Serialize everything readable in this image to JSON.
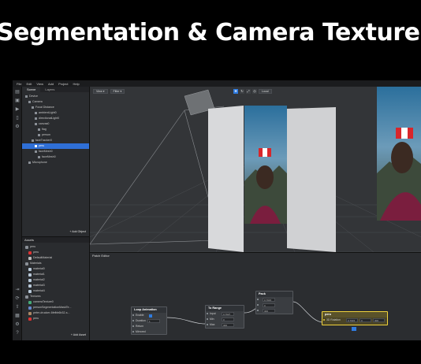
{
  "headline": "Segmentation & Camera Texture",
  "menubar": [
    "File",
    "Edit",
    "View",
    "Add",
    "Project",
    "Help"
  ],
  "tools": [
    "layers-icon",
    "picture-icon",
    "play-icon",
    "device-icon",
    "tools-icon"
  ],
  "scene_panel": {
    "tabs": [
      "Scene",
      "Layers"
    ],
    "tree": [
      {
        "label": "Device",
        "indent": 1,
        "selected": false
      },
      {
        "label": "Camera",
        "indent": 2,
        "selected": false
      },
      {
        "label": "Focal Distance",
        "indent": 3,
        "selected": false
      },
      {
        "label": "ambientLight0",
        "indent": 4,
        "selected": false
      },
      {
        "label": "directionalLight0",
        "indent": 4,
        "selected": false
      },
      {
        "label": "canvas0",
        "indent": 4,
        "selected": false
      },
      {
        "label": "flag",
        "indent": 5,
        "selected": false
      },
      {
        "label": "person",
        "indent": 5,
        "selected": false
      },
      {
        "label": "faceTracker0",
        "indent": 3,
        "selected": false
      },
      {
        "label": "peru",
        "indent": 4,
        "selected": true
      },
      {
        "label": "faceMesh0",
        "indent": 4,
        "selected": false
      },
      {
        "label": "faceMesh0",
        "indent": 5,
        "selected": false
      },
      {
        "label": "Microphone",
        "indent": 2,
        "selected": false
      }
    ],
    "add_object": "+ Add Object"
  },
  "assets_panel": {
    "title": "Assets",
    "items": [
      {
        "label": "peru",
        "indent": 1,
        "color": "#8a8f96"
      },
      {
        "label": "peru",
        "indent": 2,
        "color": "#d33"
      },
      {
        "label": "DefaultMaterial",
        "indent": 2,
        "color": "#bbb"
      },
      {
        "label": "Materials",
        "indent": 1,
        "color": "#8a8f96"
      },
      {
        "label": "material0",
        "indent": 2,
        "color": "#b8c8d8"
      },
      {
        "label": "material1",
        "indent": 2,
        "color": "#b8c8d8"
      },
      {
        "label": "material2",
        "indent": 2,
        "color": "#b8c8d8"
      },
      {
        "label": "material3",
        "indent": 2,
        "color": "#b8c8d8"
      },
      {
        "label": "material4",
        "indent": 2,
        "color": "#b8c8d8"
      },
      {
        "label": "Textures",
        "indent": 1,
        "color": "#8a8f96"
      },
      {
        "label": "cameraTexture0",
        "indent": 2,
        "color": "#4a7"
      },
      {
        "label": "personSegmentationMaskTe...",
        "indent": 2,
        "color": "#68c"
      },
      {
        "label": "peter-drucker-6fefbb6b32-s...",
        "indent": 2,
        "color": "#a86"
      },
      {
        "label": "peru",
        "indent": 2,
        "color": "#d33"
      }
    ],
    "add_asset": "+ Add Asset"
  },
  "viewport": {
    "view_dd": "View ▾",
    "filter_dd": "Filter ▾",
    "local": "Local"
  },
  "patch_editor": {
    "title": "Patch Editor",
    "nodes": {
      "loop": {
        "title": "Loop Animation",
        "rows": [
          "Enable",
          "Duration",
          "Return",
          "Mirrored"
        ],
        "duration": "1"
      },
      "to_range": {
        "title": "To Range",
        "rows": [
          "Input",
          "Min",
          "Max"
        ],
        "input": "0.7927",
        "min": "0",
        "max": "300"
      },
      "pack": {
        "title": "Pack",
        "rows": [
          "",
          "",
          ""
        ],
        "v1": "0.7915",
        "v2": "0",
        "v3": "300"
      },
      "peru": {
        "title": "peru",
        "rows": [
          "3D Rotation"
        ],
        "v1": "0.7915",
        "v2": "0",
        "v3": "300"
      }
    }
  },
  "colors": {
    "accent": "#2f7be0",
    "selected_patch": "#f0d23c"
  }
}
